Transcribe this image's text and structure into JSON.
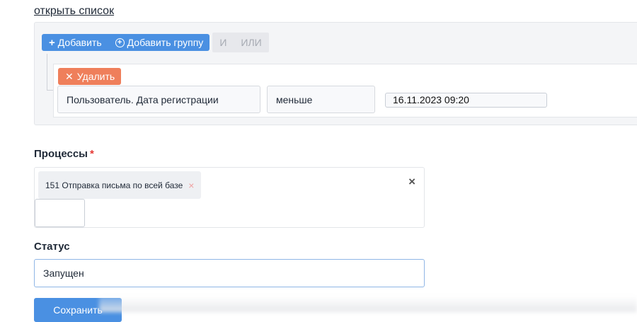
{
  "filter": {
    "open_list_link": "открыть список",
    "toolbar": {
      "add_label": "Добавить",
      "add_group_label": "Добавить группу",
      "and_label": "И",
      "or_label": "ИЛИ"
    },
    "rule": {
      "delete_label": "Удалить",
      "field": "Пользователь. Дата регистрации",
      "operator": "меньше",
      "value": "16.11.2023 09:20"
    }
  },
  "processes": {
    "label": "Процессы",
    "required_mark": "*",
    "selected": [
      {
        "label": "151 Отправка письма по всей базе",
        "remove": "×"
      }
    ],
    "clear_all": "×"
  },
  "status": {
    "label": "Статус",
    "value": "Запущен"
  },
  "save_button": "Сохранить",
  "colors": {
    "primary": "#4a90e2",
    "danger": "#ef7f5b",
    "required": "#e53935"
  }
}
